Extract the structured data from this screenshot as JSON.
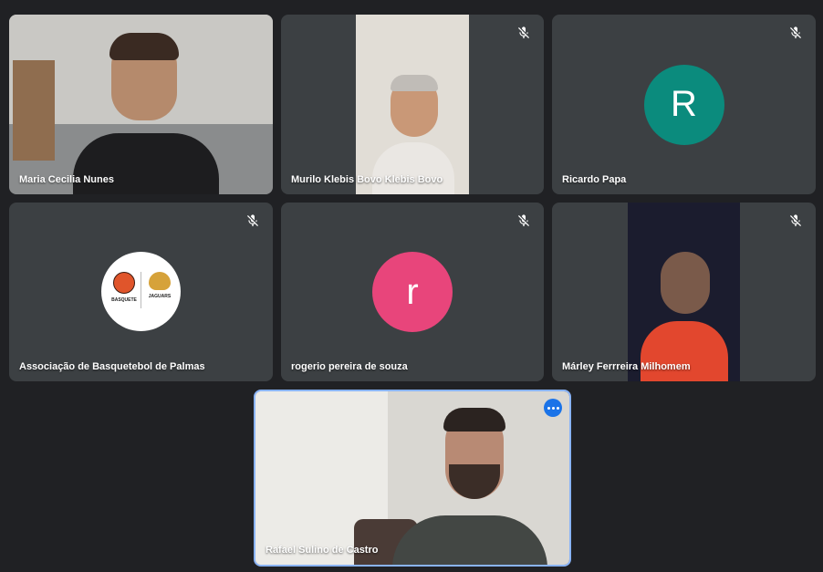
{
  "participants": [
    {
      "name": "Maria Cecilia Nunes"
    },
    {
      "name": "Murilo Klebis Bovo Klebis Bovo"
    },
    {
      "name": "Ricardo Papa",
      "initial": "R",
      "color": "#0b8b7d"
    },
    {
      "name": "Associação de Basquetebol de Palmas"
    },
    {
      "name": "rogerio pereira de souza",
      "initial": "r",
      "color": "#e8457b"
    },
    {
      "name": "Márley Ferrreira Milhomem"
    }
  ],
  "self_tile": {
    "name": "Rafael Sulino de Castro"
  },
  "logo": {
    "left": "BASQUETE",
    "right": "JAGUARS"
  },
  "colors": {
    "background": "#202124",
    "tile": "#3c4043",
    "accent": "#1a73e8"
  },
  "icons": {
    "mic_off": "mic-off-icon",
    "more": "more-options-icon"
  }
}
